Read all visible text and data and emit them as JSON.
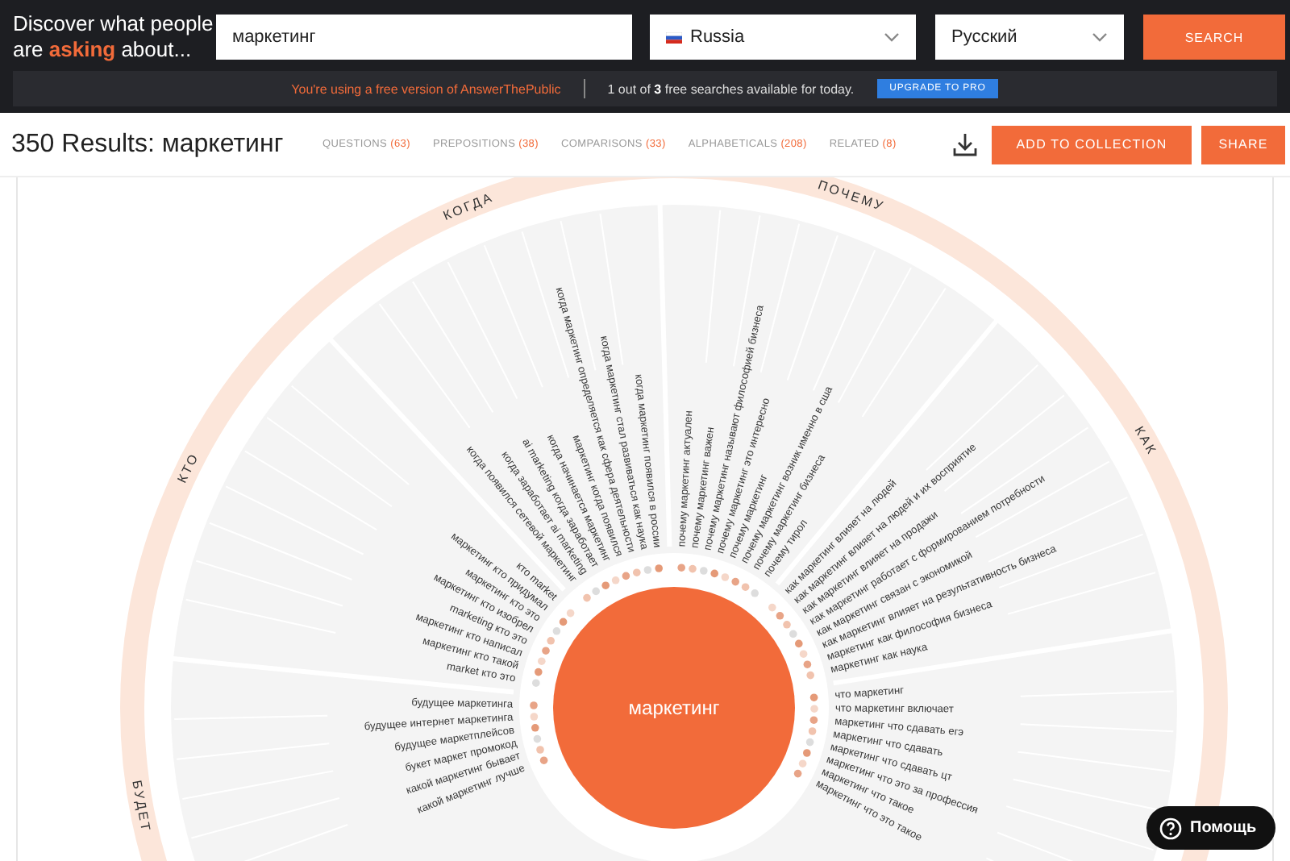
{
  "header": {
    "tagline": "Discover what people are **asking** about...",
    "search": {
      "value": "маркетинг"
    },
    "country": {
      "value": "Russia"
    },
    "language": {
      "value": "Русский"
    },
    "search_button": "SEARCH",
    "banner": {
      "notice": "You're using a free version of AnswerThePublic",
      "quota": "1 out of **3** free searches available for today.",
      "upgrade_button": "UPGRADE TO PRO"
    }
  },
  "results": {
    "title": "350 Results: маркетинг",
    "tabs": [
      {
        "label": "QUESTIONS",
        "count": "(63)",
        "selected": false
      },
      {
        "label": "PREPOSITIONS",
        "count": "(38)",
        "selected": false
      },
      {
        "label": "COMPARISONS",
        "count": "(33)",
        "selected": false
      },
      {
        "label": "ALPHABETICALS",
        "count": "(208)",
        "selected": false
      },
      {
        "label": "RELATED",
        "count": "(8)",
        "selected": false
      }
    ],
    "add_button": "ADD TO COLLECTION",
    "share_button": "SHARE"
  },
  "wheel": {
    "center_label": "маркетинг",
    "sections": [
      {
        "label": "БУДЕТ",
        "items": [
          "какой маркетинг лучше",
          "какой маркетинг бывает",
          "букет маркет промокод",
          "будущее маркетплейсов",
          "будущее интернет маркетинга",
          "будущее маркетинга"
        ]
      },
      {
        "label": "КТО",
        "items": [
          "market кто это",
          "маркетинг кто такой",
          "маркетинг кто написал",
          "marketing кто это",
          "маркетинг кто изобрел",
          "маркетинг кто это",
          "маркетинг кто придумал",
          "кто market"
        ]
      },
      {
        "label": "КОГДА",
        "items": [
          "когда появился сетевой маркетинг",
          "когда заработает ai marketing",
          "ai marketing когда заработает",
          "когда начинается маркетинг",
          "маркетинг когда появился",
          "когда маркетинг определяется как сфера деятельности",
          "когда маркетинг стал развиваться как наука",
          "когда маркетинг появился в россии"
        ]
      },
      {
        "label": "ПОЧЕМУ",
        "items": [
          "почему маркетинг актуален",
          "почему маркетинг важен",
          "почему маркетинг называют философией бизнеса",
          "почему маркетинг это интересно",
          "почему маркетинг",
          "почему маркетинг возник именно в сша",
          "почему маркетинг бизнеса",
          "почему тирол"
        ]
      },
      {
        "label": "КАК",
        "items": [
          "как маркетинг влияет на людей",
          "как маркетинг влияет на людей и их восприятие",
          "как маркетинг влияет на продажи",
          "как маркетинг работает с формированием потребности",
          "как маркетинг связан с экономикой",
          "как маркетинг влияет на результативность бизнеса",
          "маркетинг как философия бизнеса",
          "маркетинг как наука"
        ]
      },
      {
        "items": [
          "что маркетинг",
          "что маркетинг включает",
          "маркетинг что сдавать егэ",
          "маркетинг что сдавать",
          "маркетинг что сдавать цт",
          "маркетинг что это за профессия",
          "маркетинг что такое",
          "маркетинг что это такое"
        ]
      }
    ]
  },
  "help_button": "Помощь"
}
